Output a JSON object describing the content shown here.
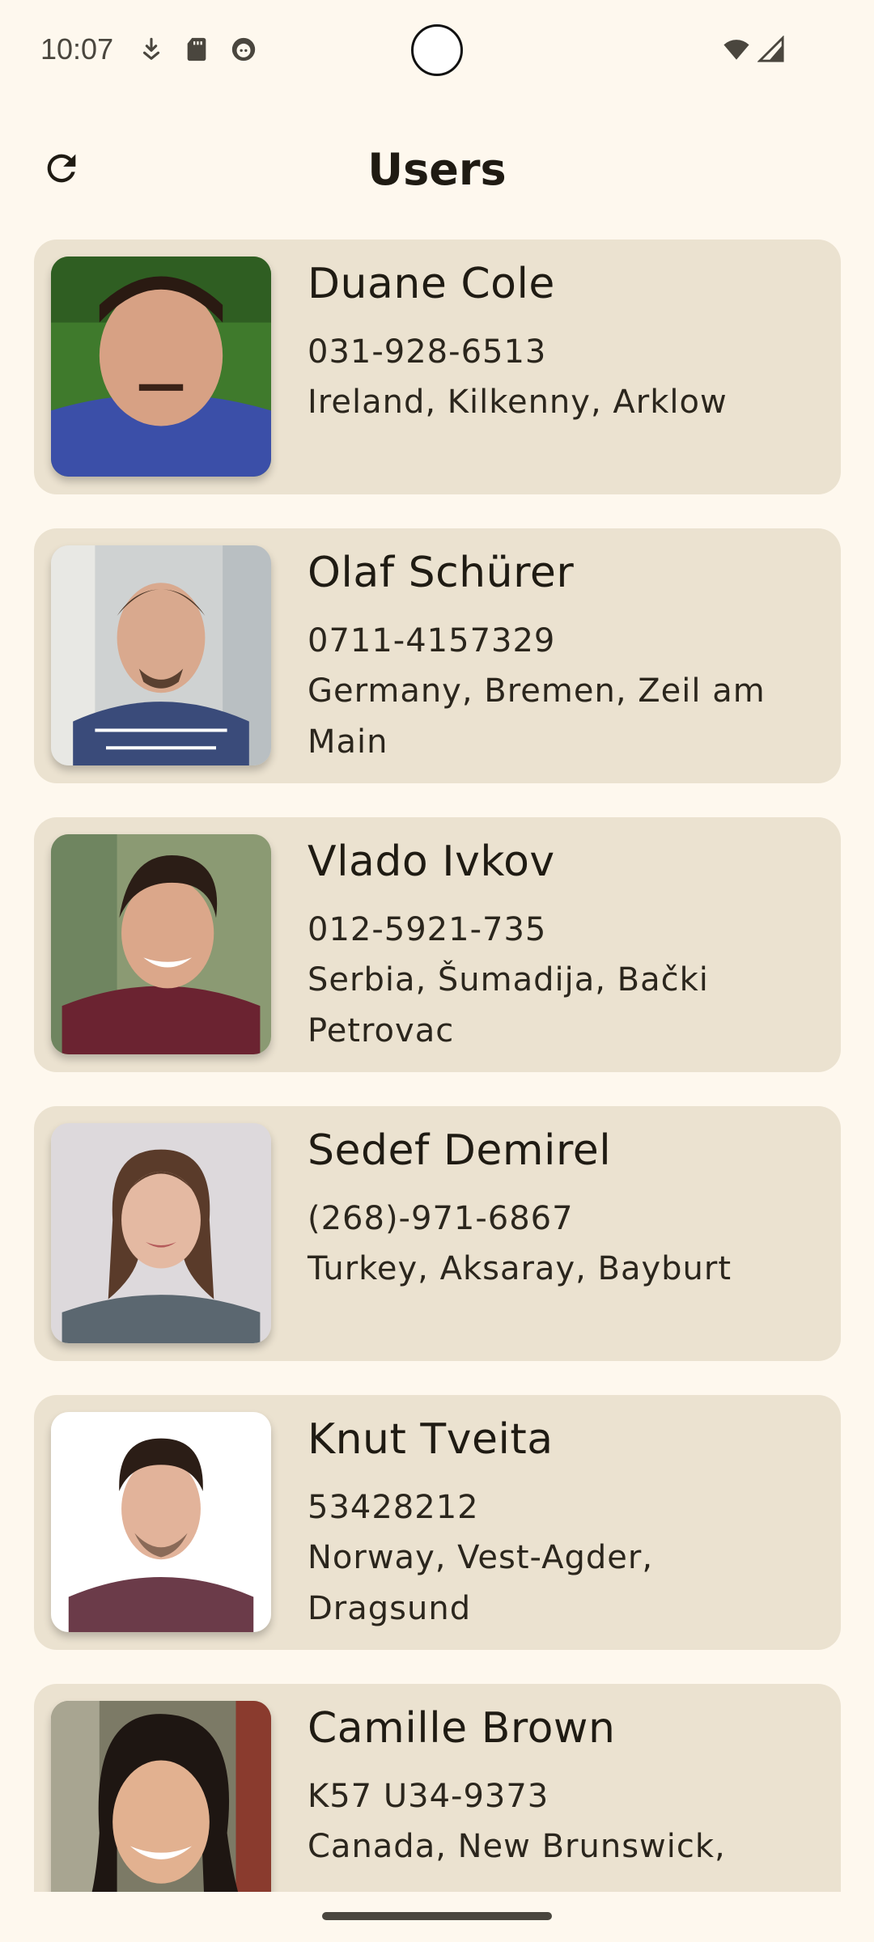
{
  "status_bar": {
    "time": "10:07",
    "icons": [
      "download-indicator-icon",
      "sd-card-icon",
      "app-notification-icon",
      "wifi-icon",
      "cellular-signal-icon"
    ]
  },
  "app_bar": {
    "title": "Users",
    "refresh_icon": "refresh-icon"
  },
  "users": [
    {
      "name": "Duane Cole",
      "phone": "031-928-6513",
      "location": "Ireland, Kilkenny, Arklow"
    },
    {
      "name": "Olaf Schürer",
      "phone": "0711-4157329",
      "location": "Germany, Bremen, Zeil am Main"
    },
    {
      "name": "Vlado Ivkov",
      "phone": "012-5921-735",
      "location": "Serbia, Šumadija, Bački Petrovac"
    },
    {
      "name": "Sedef Demirel",
      "phone": "(268)-971-6867",
      "location": "Turkey, Aksaray, Bayburt"
    },
    {
      "name": "Knut Tveita",
      "phone": "53428212",
      "location": "Norway, Vest-Agder, Dragsund"
    },
    {
      "name": "Camille Brown",
      "phone": "K57 U34-9373",
      "location": "Canada, New Brunswick,"
    }
  ],
  "colors": {
    "background": "#fef8ee",
    "card": "#ebe2d0",
    "text": "#1f1b13"
  }
}
